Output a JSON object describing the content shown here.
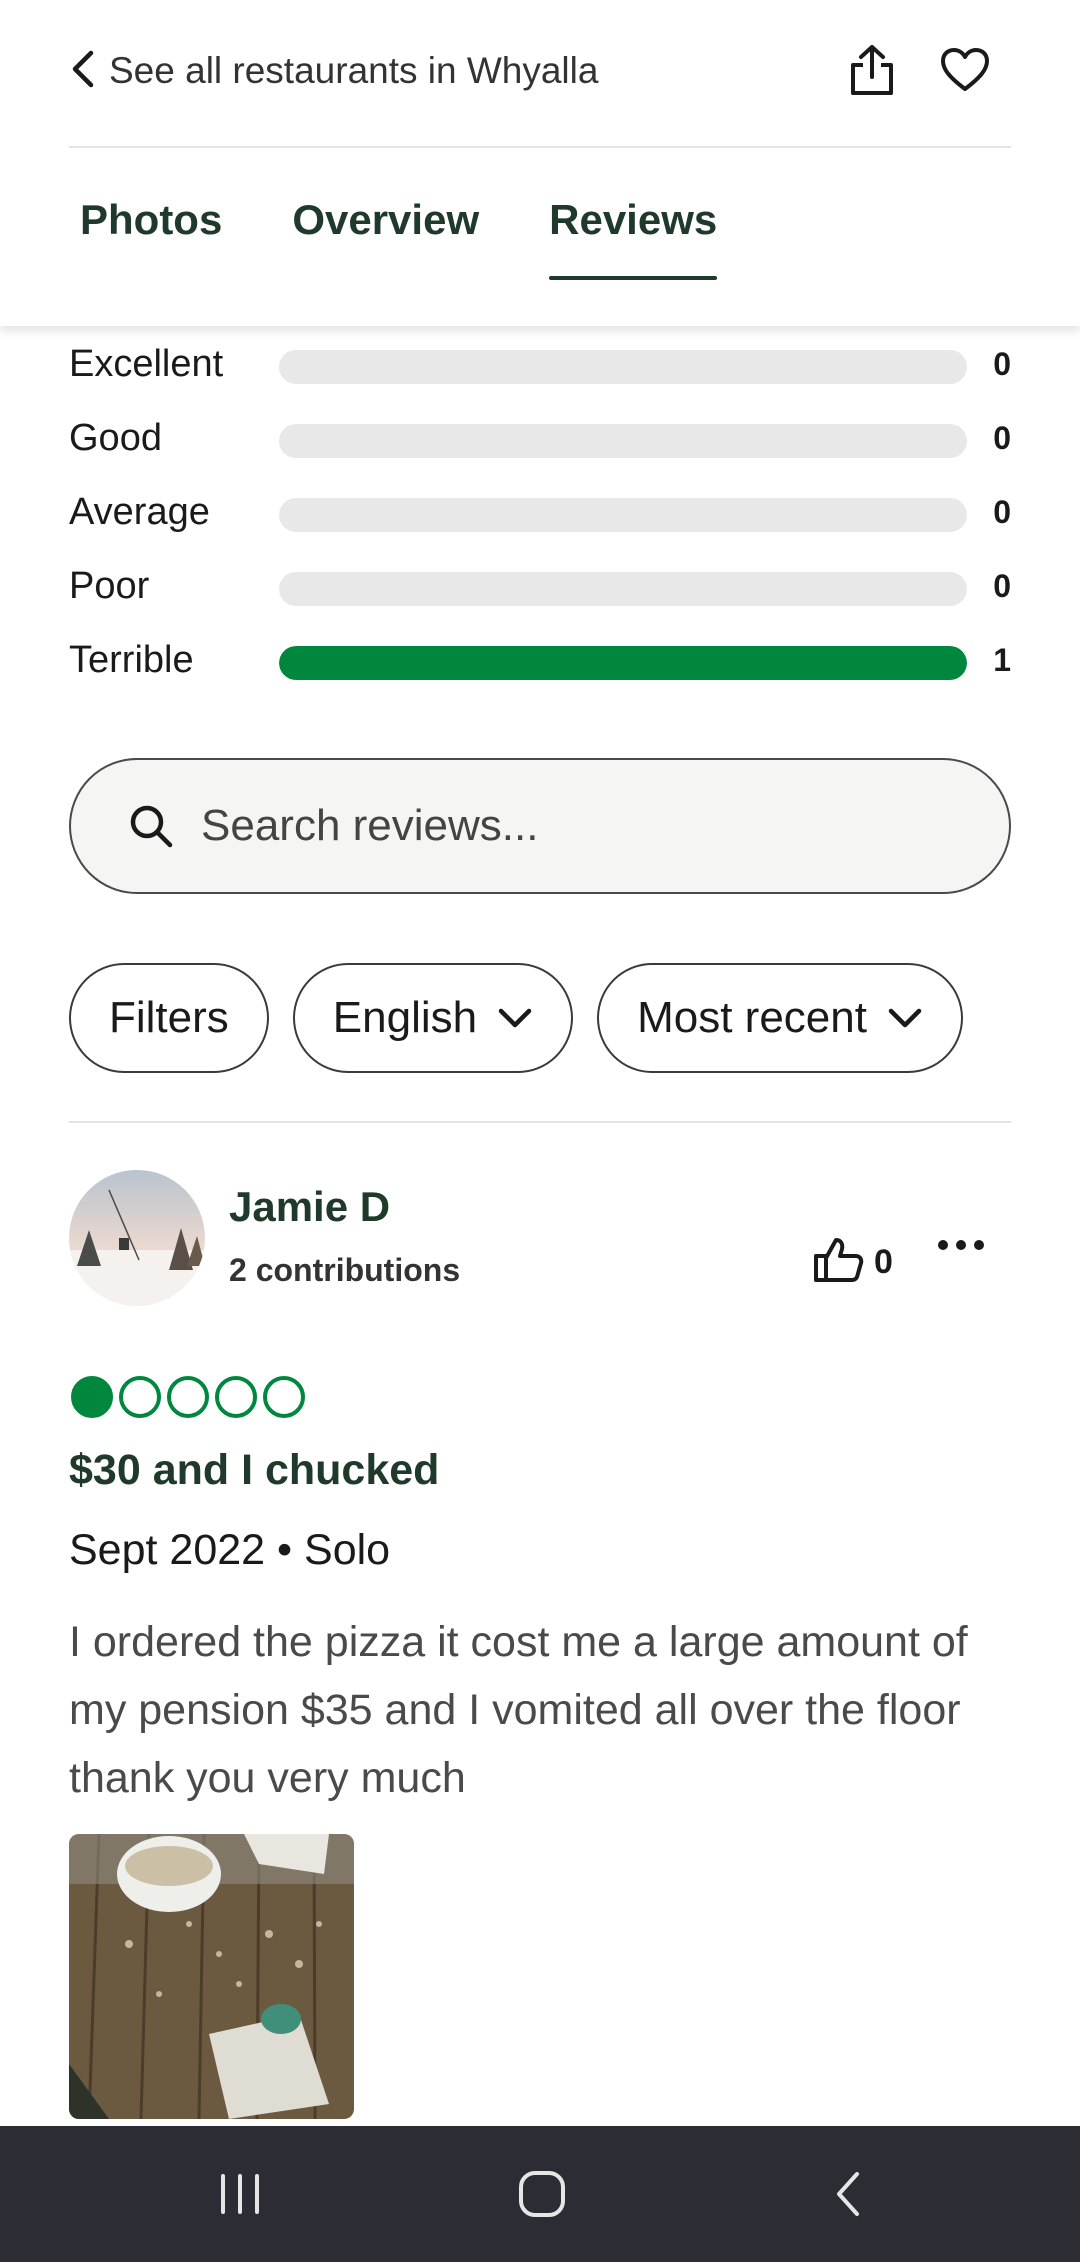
{
  "header": {
    "back_label": "See all restaurants in Whyalla",
    "tabs": [
      {
        "label": "Photos",
        "active": false
      },
      {
        "label": "Overview",
        "active": false
      },
      {
        "label": "Reviews",
        "active": true
      }
    ]
  },
  "ratings": [
    {
      "label": "Excellent",
      "count": "0",
      "fill_fraction": 0
    },
    {
      "label": "Good",
      "count": "0",
      "fill_fraction": 0
    },
    {
      "label": "Average",
      "count": "0",
      "fill_fraction": 0
    },
    {
      "label": "Poor",
      "count": "0",
      "fill_fraction": 0
    },
    {
      "label": "Terrible",
      "count": "1",
      "fill_fraction": 1
    }
  ],
  "search": {
    "placeholder": "Search reviews..."
  },
  "filters": {
    "filters_label": "Filters",
    "language_label": "English",
    "sort_label": "Most recent"
  },
  "review": {
    "user_name": "Jamie D",
    "contributions": "2 contributions",
    "likes": "0",
    "rating": 1,
    "rating_max": 5,
    "title": "$30 and I chucked",
    "meta": "Sept 2022 • Solo",
    "body": "I ordered the pizza it cost me a large amount of my pension $35 and I vomited all over the floor thank you very much"
  },
  "colors": {
    "accent_green": "#00873e",
    "dark_green_text": "#1f3a2a",
    "track_grey": "#e8e8e8",
    "navbar": "#2c2c34"
  }
}
